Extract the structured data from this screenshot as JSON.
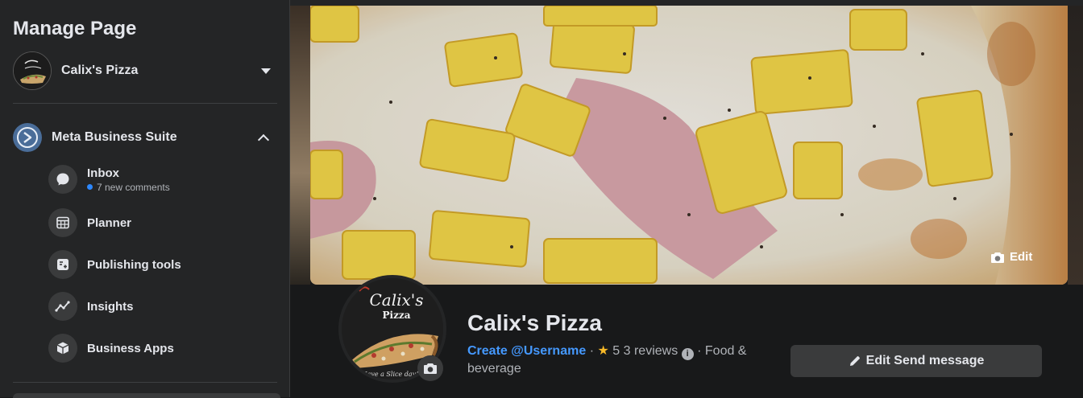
{
  "sidebar": {
    "title": "Manage Page",
    "page_switcher": {
      "name": "Calix's Pizza"
    },
    "meta_business_suite": {
      "label": "Meta Business Suite"
    },
    "items": [
      {
        "label": "Inbox",
        "sub": "7 new comments",
        "icon": "chat-bubble-icon"
      },
      {
        "label": "Planner",
        "icon": "calendar-icon"
      },
      {
        "label": "Publishing tools",
        "icon": "publishing-tools-icon"
      },
      {
        "label": "Insights",
        "icon": "insights-icon"
      },
      {
        "label": "Business Apps",
        "icon": "cube-icon"
      }
    ]
  },
  "cover": {
    "edit_label": "Edit"
  },
  "profile": {
    "name": "Calix's Pizza",
    "logo_text": "Calix's",
    "logo_sub": "Pizza",
    "logo_tagline": "Have a Slice day!",
    "username_link": "Create @Username",
    "rating": "5",
    "reviews": "3 reviews",
    "category": "Food & beverage",
    "action_label": "Edit Send message"
  },
  "colors": {
    "accent": "#4599ff",
    "notification_dot": "#2d88ff",
    "star": "#f7b928"
  }
}
